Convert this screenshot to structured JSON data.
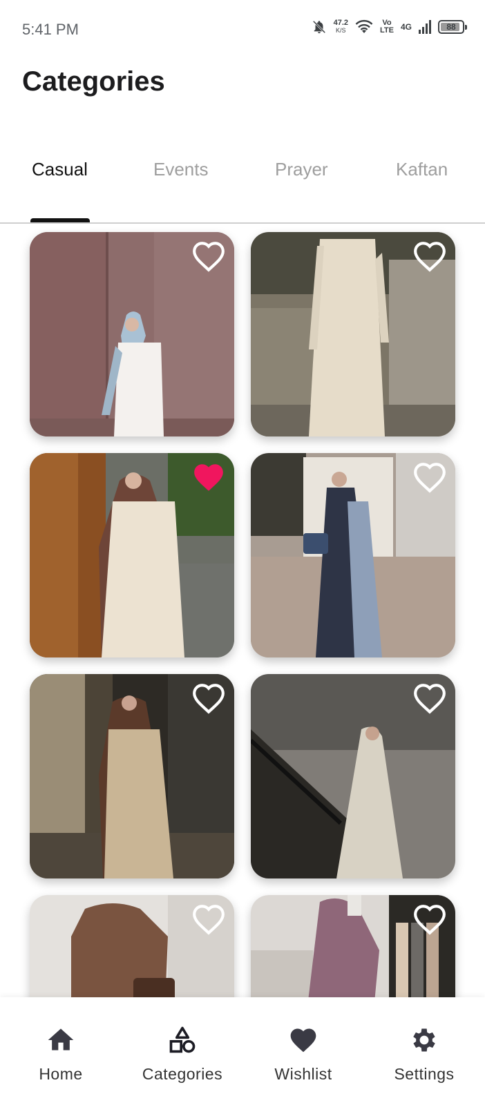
{
  "status_bar": {
    "time": "5:41 PM",
    "net_speed": "47.2",
    "net_unit": "K/S",
    "volte_top": "Vo",
    "volte_bottom": "LTE",
    "network": "4G",
    "battery": "88"
  },
  "header": {
    "title": "Categories"
  },
  "tabs": [
    {
      "label": "Casual",
      "active": true
    },
    {
      "label": "Events",
      "active": false
    },
    {
      "label": "Prayer",
      "active": false
    },
    {
      "label": "Kaftan",
      "active": false
    }
  ],
  "products": [
    {
      "image": "abaya-white-light-blue-hijab",
      "favorite": false,
      "icon": "heart-outline-icon"
    },
    {
      "image": "abaya-cream-split",
      "favorite": false,
      "icon": "heart-outline-icon"
    },
    {
      "image": "abaya-beige-mauve-hijab",
      "favorite": true,
      "icon": "heart-filled-icon"
    },
    {
      "image": "kimono-blue-tie-dye",
      "favorite": false,
      "icon": "heart-outline-icon"
    },
    {
      "image": "abaya-tan-brown-hijab",
      "favorite": false,
      "icon": "heart-outline-icon"
    },
    {
      "image": "abaya-white-satin-staircase",
      "favorite": false,
      "icon": "heart-outline-icon"
    },
    {
      "image": "abaya-brown-bell-sleeve",
      "favorite": false,
      "icon": "heart-outline-icon"
    },
    {
      "image": "abaya-mauve-mirror-selfie",
      "favorite": false,
      "icon": "heart-outline-icon"
    }
  ],
  "colors": {
    "favorite": "#f0165e",
    "active_text": "#111111",
    "inactive_text": "#9e9e9e",
    "nav_icon": "#3a3a44"
  },
  "bottom_nav": [
    {
      "label": "Home",
      "icon": "home-icon"
    },
    {
      "label": "Categories",
      "icon": "categories-icon"
    },
    {
      "label": "Wishlist",
      "icon": "wishlist-heart-icon"
    },
    {
      "label": "Settings",
      "icon": "settings-gear-icon"
    }
  ]
}
